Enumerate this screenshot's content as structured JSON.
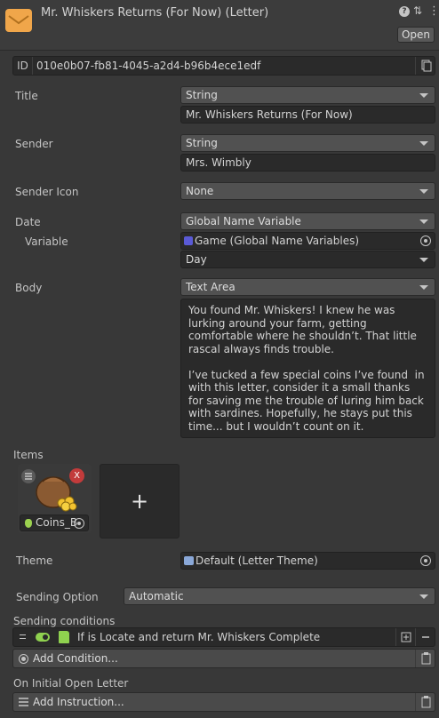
{
  "header": {
    "title": "Mr. Whiskers Returns (For Now) (Letter)",
    "open_label": "Open",
    "help_icon": "?",
    "settings_icon": "⇅",
    "more_icon": "⋮"
  },
  "id_row": {
    "label": "ID",
    "value": "010e0b07-fb81-4045-a2d4-b96b4ece1edf"
  },
  "title_field": {
    "label": "Title",
    "type": "String",
    "value": "Mr. Whiskers Returns (For Now)"
  },
  "sender_field": {
    "label": "Sender",
    "type": "String",
    "value": "Mrs. Wimbly"
  },
  "sender_icon_field": {
    "label": "Sender Icon",
    "value": "None"
  },
  "date_field": {
    "label": "Date",
    "type": "Global Name Variable",
    "variable_label": "Variable",
    "variable_value": "Game (Global Name Variables)",
    "day_value": "Day"
  },
  "body_field": {
    "label": "Body",
    "type": "Text Area",
    "text": "You found Mr. Whiskers! I knew he was lurking around your farm, getting comfortable where he shouldn’t. That little rascal always finds trouble.\n\nI’ve tucked a few special coins I’ve found  in with this letter, consider it a small thanks for saving me the trouble of luring him back with sardines. Hopefully, he stays put this time... but I wouldn’t count on it."
  },
  "items": {
    "label": "Items",
    "item_name": "Coins_B",
    "remove_label": "X",
    "add_label": "+"
  },
  "theme": {
    "label": "Theme",
    "value": "Default (Letter Theme)"
  },
  "sending_option": {
    "label": "Sending Option",
    "value": "Automatic"
  },
  "sending_conditions": {
    "label": "Sending conditions",
    "condition_text": "If is Locate and return Mr. Whiskers Complete",
    "add_condition_label": "Add Condition..."
  },
  "on_open": {
    "label": "On Initial Open Letter",
    "add_instruction_label": "Add Instruction..."
  },
  "colors": {
    "background": "#383838",
    "icon_orange": "#f0a64a",
    "remove_red": "#c23b3b",
    "toggle_green": "#8fd14f"
  }
}
